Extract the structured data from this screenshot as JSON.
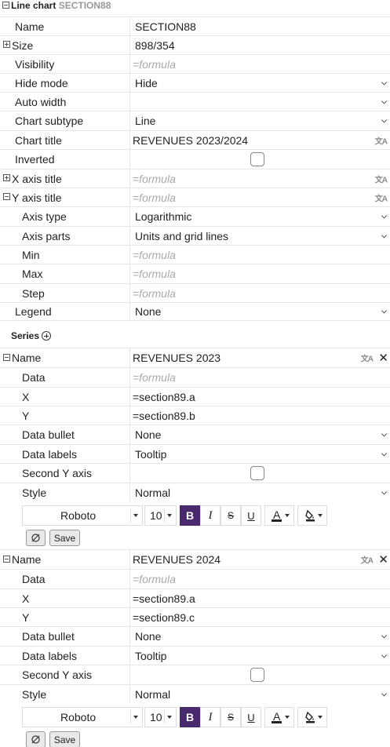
{
  "header": {
    "title": "Line chart",
    "section": "SECTION88"
  },
  "props": {
    "name": {
      "label": "Name",
      "value": "SECTION88"
    },
    "size": {
      "label": "Size",
      "value": "898/354"
    },
    "visibility": {
      "label": "Visibility",
      "placeholder": "=formula"
    },
    "hide_mode": {
      "label": "Hide mode",
      "value": "Hide"
    },
    "auto_width": {
      "label": "Auto width",
      "value": ""
    },
    "chart_subtype": {
      "label": "Chart subtype",
      "value": "Line"
    },
    "chart_title": {
      "label": "Chart title",
      "value": "REVENUES 2023/2024"
    },
    "inverted": {
      "label": "Inverted",
      "checked": false
    },
    "x_axis_title": {
      "label": "X axis title",
      "placeholder": "=formula"
    },
    "y_axis_title": {
      "label": "Y axis title",
      "placeholder": "=formula"
    },
    "axis_type": {
      "label": "Axis type",
      "value": "Logarithmic"
    },
    "axis_parts": {
      "label": "Axis parts",
      "value": "Units and grid lines"
    },
    "min": {
      "label": "Min",
      "placeholder": "=formula"
    },
    "max": {
      "label": "Max",
      "placeholder": "=formula"
    },
    "step": {
      "label": "Step",
      "placeholder": "=formula"
    },
    "legend": {
      "label": "Legend",
      "value": "None"
    }
  },
  "series_header": "Series",
  "series": [
    {
      "name_label": "Name",
      "name": "REVENUES 2023",
      "data_label": "Data",
      "data_placeholder": "=formula",
      "x_label": "X",
      "x": "=section89.a",
      "y_label": "Y",
      "y": "=section89.b",
      "bullet_label": "Data bullet",
      "bullet": "None",
      "labels_label": "Data labels",
      "labels": "Tooltip",
      "second_y_label": "Second Y axis",
      "second_y": false,
      "style_label": "Style",
      "style": "Normal",
      "font": "Roboto",
      "font_size": "10",
      "save_label": "Save"
    },
    {
      "name_label": "Name",
      "name": "REVENUES 2024",
      "data_label": "Data",
      "data_placeholder": "=formula",
      "x_label": "X",
      "x": "=section89.a",
      "y_label": "Y",
      "y": "=section89.c",
      "bullet_label": "Data bullet",
      "bullet": "None",
      "labels_label": "Data labels",
      "labels": "Tooltip",
      "second_y_label": "Second Y axis",
      "second_y": false,
      "style_label": "Style",
      "style": "Normal",
      "font": "Roboto",
      "font_size": "10",
      "save_label": "Save"
    }
  ],
  "toolbar_glyphs": {
    "bold": "B",
    "italic": "I",
    "strike": "S",
    "underline": "U",
    "color": "A",
    "translate": "文A",
    "close": "✕"
  }
}
